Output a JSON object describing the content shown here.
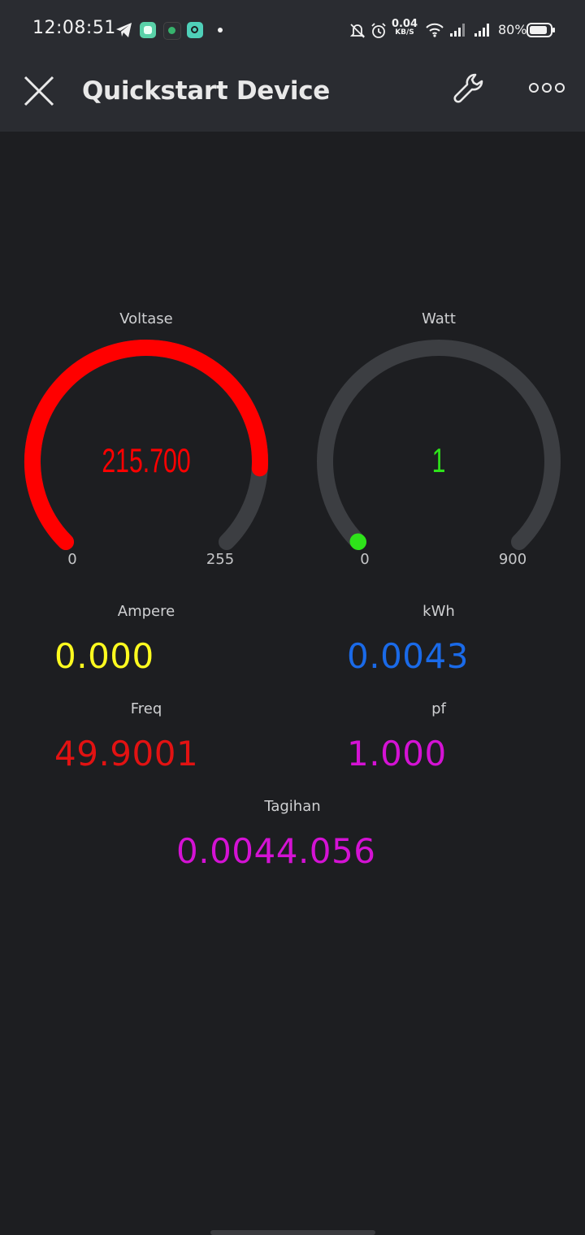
{
  "status_bar": {
    "time": "12:08:51",
    "net_speed_value": "0.04",
    "net_speed_unit": "KB/S",
    "battery": "80%"
  },
  "app_bar": {
    "title": "Quickstart Device"
  },
  "gauges": [
    {
      "label": "Voltase",
      "value": "215.700",
      "min": "0",
      "max": "255",
      "fraction": 0.846,
      "color": "#ff0000"
    },
    {
      "label": "Watt",
      "value": "1",
      "min": "0",
      "max": "900",
      "fraction": 0.0011,
      "color": "#2ee31a"
    }
  ],
  "values": {
    "ampere": {
      "label": "Ampere",
      "value": "0.000",
      "color": "#fffb1f"
    },
    "kwh": {
      "label": "kWh",
      "value": "0.0043",
      "color": "#1a6ae8"
    },
    "freq": {
      "label": "Freq",
      "value": "49.9001",
      "color": "#e21212"
    },
    "pf": {
      "label": "pf",
      "value": "1.000",
      "color": "#d412d4"
    },
    "tagihan": {
      "label": "Tagihan",
      "value": "0.0044.056",
      "color": "#d412d4"
    }
  },
  "colors": {
    "background": "#1d1e21",
    "bar": "#2a2c31",
    "gauge_track": "#3c3e42"
  },
  "icons": [
    "telegram-icon",
    "app-icon",
    "app-icon",
    "app-icon",
    "notification-dot-icon",
    "bell-off-icon",
    "alarm-icon",
    "wifi-icon",
    "signal-icon",
    "battery-icon",
    "close-icon",
    "wrench-icon",
    "more-icon"
  ]
}
